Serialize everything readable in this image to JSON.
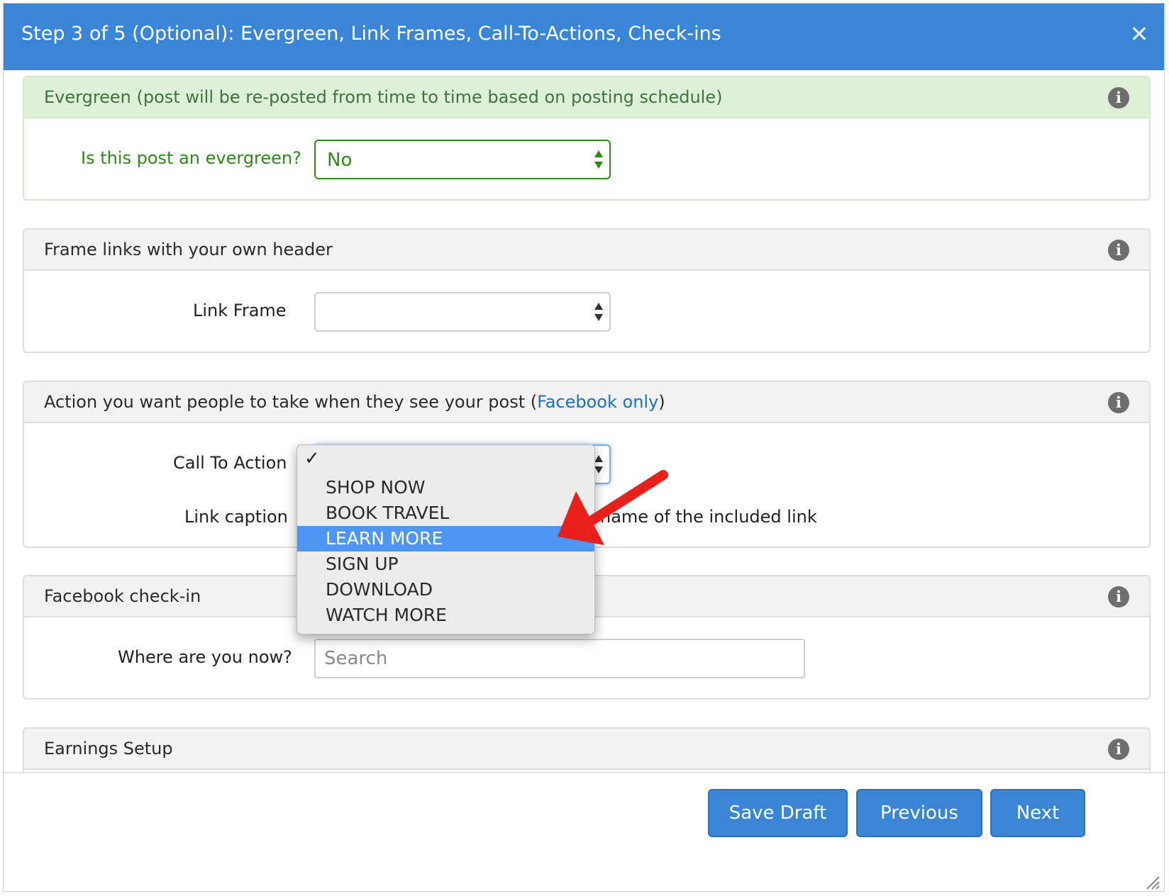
{
  "modal": {
    "title": "Step 3 of 5 (Optional): Evergreen, Link Frames, Call-To-Actions, Check-ins",
    "close_icon": "close-icon"
  },
  "evergreen": {
    "heading": "Evergreen (post will be re-posted from time to time based on posting schedule)",
    "question_label": "Is this post an evergreen?",
    "selected": "No"
  },
  "link_frame": {
    "heading": "Frame links with your own header",
    "label": "Link Frame",
    "selected": ""
  },
  "call_to_action": {
    "heading_prefix": "Action you want people to take when they see your post (",
    "heading_link": "Facebook only",
    "heading_suffix": ")",
    "cta_label": "Call To Action",
    "caption_label": "Link caption",
    "caption_text": "name of the included link",
    "dropdown": {
      "check_mark": "✓",
      "options": [
        "SHOP NOW",
        "BOOK TRAVEL",
        "LEARN MORE",
        "SIGN UP",
        "DOWNLOAD",
        "WATCH MORE"
      ],
      "highlighted": "LEARN MORE"
    }
  },
  "checkin": {
    "heading": "Facebook check-in",
    "label": "Where are you now?",
    "search_placeholder": "Search"
  },
  "earnings": {
    "heading": "Earnings Setup"
  },
  "footer": {
    "save_draft": "Save Draft",
    "previous": "Previous",
    "next": "Next"
  },
  "colors": {
    "header_blue": "#3a85d6",
    "evergreen_green": "#2e8b16",
    "highlight_blue": "#4d96f3",
    "annotation_arrow": "#e8201b"
  }
}
